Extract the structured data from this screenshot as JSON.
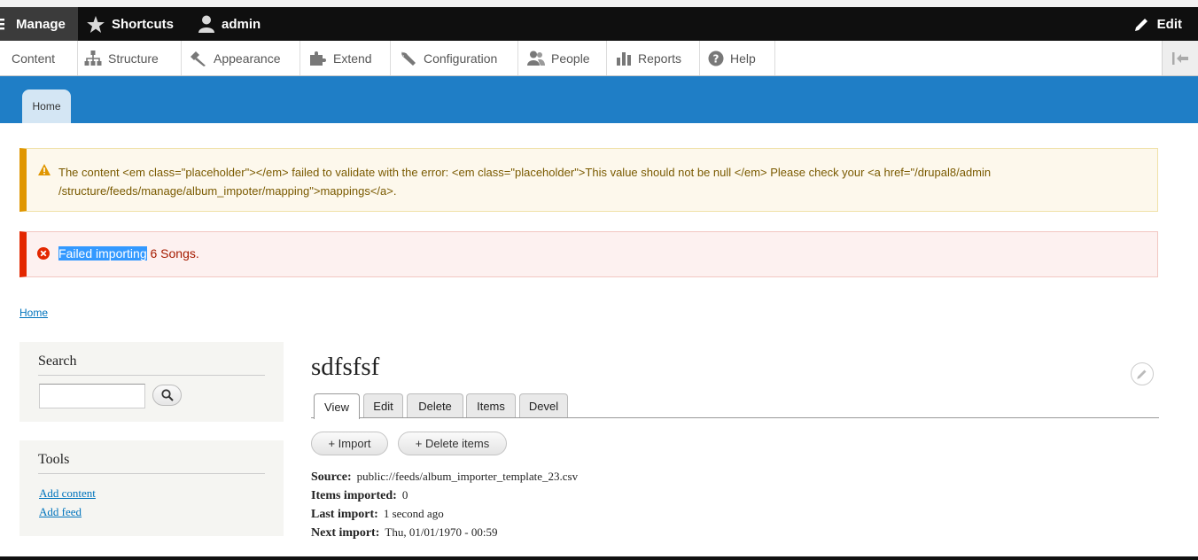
{
  "toolbar": {
    "manage": "Manage",
    "shortcuts": "Shortcuts",
    "user": "admin",
    "edit": "Edit"
  },
  "tray": {
    "items": [
      {
        "label": "Content",
        "icon": "content-icon"
      },
      {
        "label": "Structure",
        "icon": "structure-icon"
      },
      {
        "label": "Appearance",
        "icon": "appearance-icon"
      },
      {
        "label": "Extend",
        "icon": "extend-icon"
      },
      {
        "label": "Configuration",
        "icon": "configuration-icon"
      },
      {
        "label": "People",
        "icon": "people-icon"
      },
      {
        "label": "Reports",
        "icon": "reports-icon"
      },
      {
        "label": "Help",
        "icon": "help-icon"
      }
    ]
  },
  "header": {
    "home_tab": "Home",
    "accent": "#1f7ec6"
  },
  "messages": {
    "warning_line1": "The content <em class=\"placeholder\"></em> failed to validate with the error: <em class=\"placeholder\">This value should not be null </em> Please check your <a href=\"/drupal8/admin",
    "warning_line2": "/structure/feeds/manage/album_impoter/mapping\">mappings</a>.",
    "error_selected": "Failed importing",
    "error_rest": " 6 Songs."
  },
  "breadcrumb": {
    "home": "Home"
  },
  "sidebar": {
    "search_title": "Search",
    "search_value": "",
    "tools_title": "Tools",
    "tools_links": [
      "Add content",
      "Add feed"
    ]
  },
  "main": {
    "title": "sdfsfsf",
    "tabs": [
      "View",
      "Edit",
      "Delete",
      "Items",
      "Devel"
    ],
    "actions": [
      "+ Import",
      "+ Delete items"
    ],
    "fields": {
      "source_label": "Source:",
      "source_value": "public://feeds/album_importer_template_23.csv",
      "items_label": "Items imported:",
      "items_value": "0",
      "last_label": "Last import:",
      "last_value": "1 second ago",
      "next_label": "Next import:",
      "next_value": "Thu, 01/01/1970 - 00:59"
    }
  }
}
